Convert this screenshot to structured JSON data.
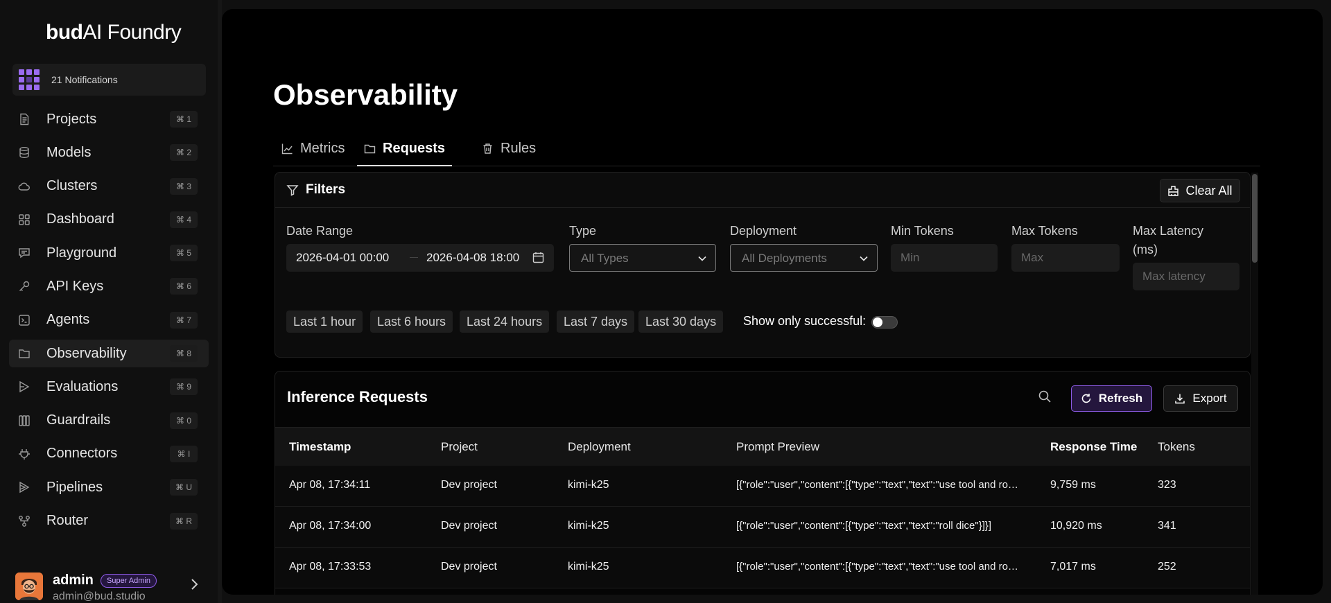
{
  "brand": {
    "logo_bold": "bud",
    "logo_rest": "AI Foundry"
  },
  "notifications": {
    "label": "21 Notifications"
  },
  "sidebar": {
    "items": [
      {
        "label": "Projects",
        "shortcut": "⌘ 1"
      },
      {
        "label": "Models",
        "shortcut": "⌘ 2"
      },
      {
        "label": "Clusters",
        "shortcut": "⌘ 3"
      },
      {
        "label": "Dashboard",
        "shortcut": "⌘ 4"
      },
      {
        "label": "Playground",
        "shortcut": "⌘ 5"
      },
      {
        "label": "API Keys",
        "shortcut": "⌘ 6"
      },
      {
        "label": "Agents",
        "shortcut": "⌘ 7"
      },
      {
        "label": "Observability",
        "shortcut": "⌘ 8",
        "active": true
      },
      {
        "label": "Evaluations",
        "shortcut": "⌘ 9"
      },
      {
        "label": "Guardrails",
        "shortcut": "⌘ 0"
      },
      {
        "label": "Connectors",
        "shortcut": "⌘ I"
      },
      {
        "label": "Pipelines",
        "shortcut": "⌘ U"
      },
      {
        "label": "Router",
        "shortcut": "⌘ R"
      }
    ]
  },
  "user": {
    "name": "admin",
    "role": "Super Admin",
    "email": "admin@bud.studio"
  },
  "page": {
    "title": "Observability"
  },
  "tabs": [
    {
      "label": "Metrics",
      "icon": "line-chart-icon"
    },
    {
      "label": "Requests",
      "icon": "folder-icon",
      "active": true
    },
    {
      "label": "Rules",
      "icon": "trash-icon"
    }
  ],
  "filters": {
    "title": "Filters",
    "clear_all": "Clear All",
    "date_range": {
      "label": "Date Range",
      "start": "2026-04-01 00:00",
      "end": "2026-04-08 18:00"
    },
    "type": {
      "label": "Type",
      "value": "All Types"
    },
    "deployment": {
      "label": "Deployment",
      "value": "All Deployments"
    },
    "min_tokens": {
      "label": "Min Tokens",
      "placeholder": "Min"
    },
    "max_tokens": {
      "label": "Max Tokens",
      "placeholder": "Max"
    },
    "max_latency": {
      "label_line1": "Max Latency",
      "label_line2": "(ms)",
      "placeholder": "Max latency"
    },
    "quick_ranges": [
      "Last 1 hour",
      "Last 6 hours",
      "Last 24 hours",
      "Last 7 days",
      "Last 30 days"
    ],
    "success_toggle": {
      "label": "Show only successful:",
      "on": false
    }
  },
  "requests": {
    "title": "Inference Requests",
    "refresh": "Refresh",
    "export": "Export",
    "columns": [
      "Timestamp",
      "Project",
      "Deployment",
      "Prompt Preview",
      "Response Time",
      "Tokens"
    ],
    "rows": [
      {
        "timestamp": "Apr 08, 17:34:11",
        "project": "Dev project",
        "deployment": "kimi-k25",
        "prompt": "[{\"role\":\"user\",\"content\":[{\"type\":\"text\",\"text\":\"use tool and roll a dice\"}]}]",
        "response_time": "9,759 ms",
        "tokens": "323"
      },
      {
        "timestamp": "Apr 08, 17:34:00",
        "project": "Dev project",
        "deployment": "kimi-k25",
        "prompt": "[{\"role\":\"user\",\"content\":[{\"type\":\"text\",\"text\":\"roll dice\"}]}]",
        "response_time": "10,920 ms",
        "tokens": "341"
      },
      {
        "timestamp": "Apr 08, 17:33:53",
        "project": "Dev project",
        "deployment": "kimi-k25",
        "prompt": "[{\"role\":\"user\",\"content\":[{\"type\":\"text\",\"text\":\"use tool and roll a dice\"}]}]",
        "response_time": "7,017 ms",
        "tokens": "252"
      }
    ]
  },
  "colors": {
    "accent": "#8f5ce8",
    "accent_bg": "#24163d",
    "background": "#000000",
    "sidebar": "#101010"
  }
}
